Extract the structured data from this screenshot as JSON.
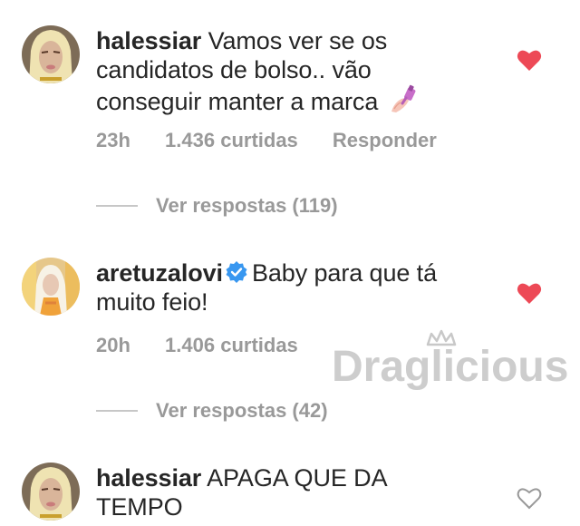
{
  "comments": [
    {
      "username": "halessiar",
      "text_line1": "Vamos ver se os",
      "text_line2": "candidatos de bolso.. vão",
      "text_line3": "conseguir manter a marca",
      "emoji_icon": "nail-polish-icon",
      "time": "23h",
      "likes": "1.436 curtidas",
      "reply": "Responder",
      "liked": true,
      "replies_label": "Ver respostas (119)"
    },
    {
      "username": "aretuzalovi",
      "verified": true,
      "text_line1": "Baby para que tá",
      "text_line2": "muito feio!",
      "time": "20h",
      "likes": "1.406 curtidas",
      "liked": true,
      "replies_label": "Ver respostas (42)"
    },
    {
      "username": "halessiar",
      "text_line1": "APAGA QUE DA",
      "text_line2": "TEMPO",
      "liked": false
    }
  ],
  "watermark": "Draglicious",
  "colors": {
    "text": "#262626",
    "muted": "#999999",
    "heart": "#ed4956",
    "verified": "#3897f0",
    "watermark": "#c8c8c8"
  }
}
